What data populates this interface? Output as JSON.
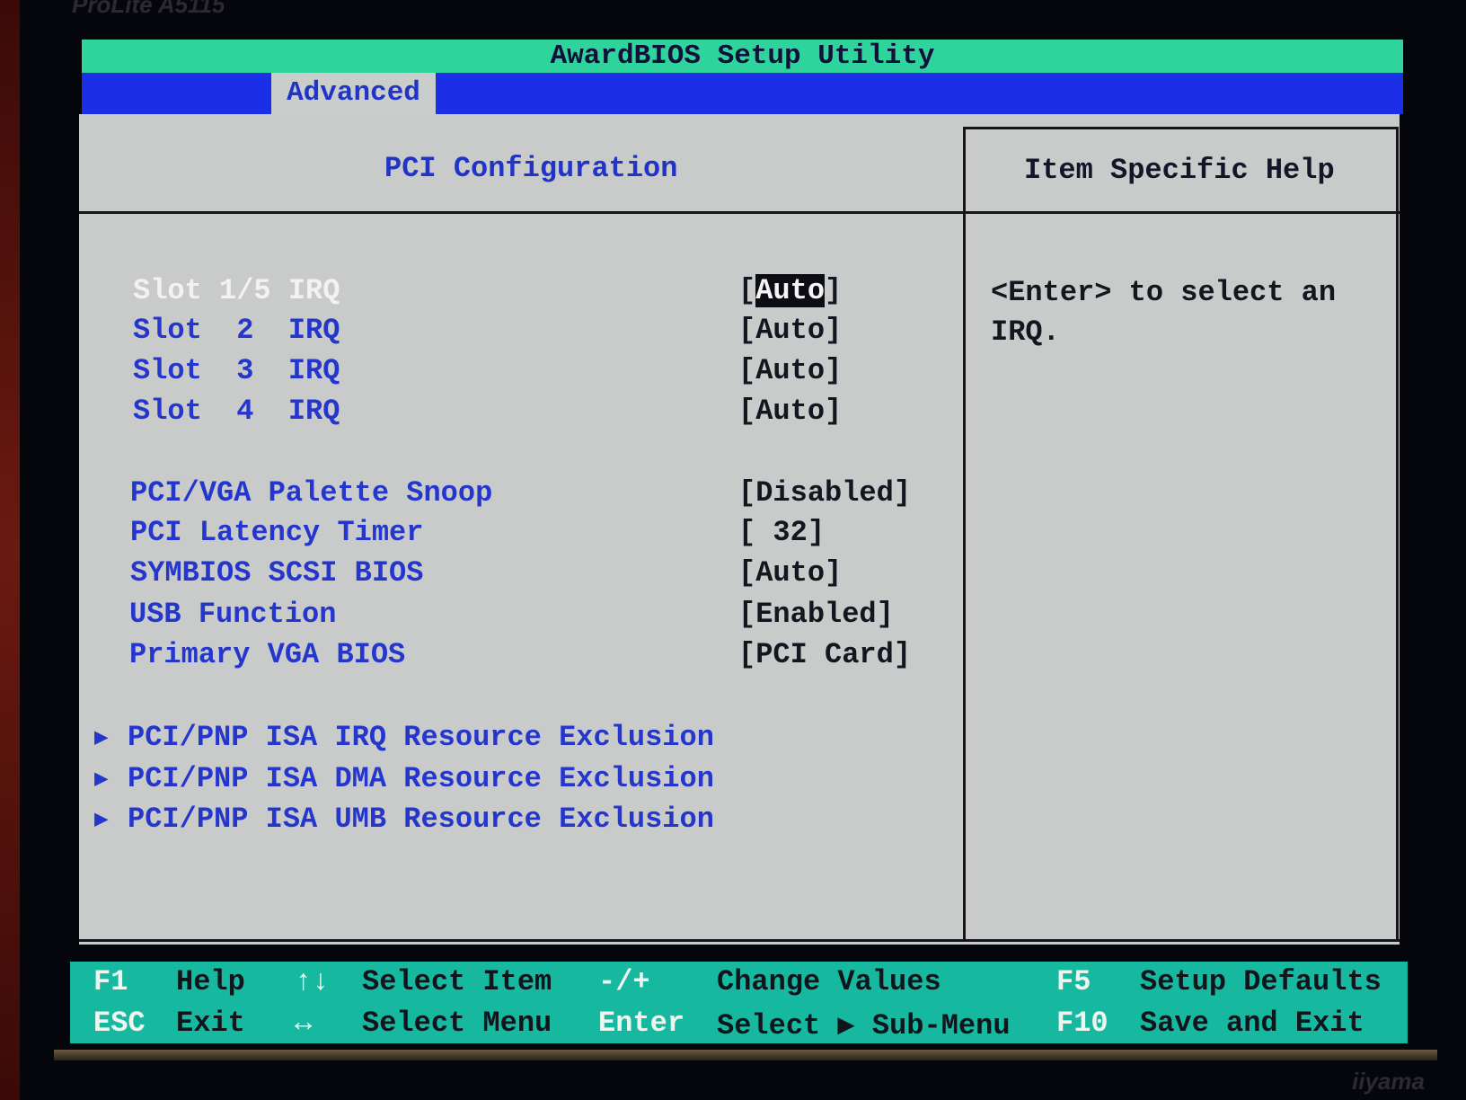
{
  "monitor": {
    "model": "ProLite A5115",
    "brand": "iiyama"
  },
  "title": "AwardBIOS Setup Utility",
  "menu": {
    "tabs": [
      {
        "label": "Advanced",
        "active": true
      }
    ]
  },
  "panel": {
    "header": "PCI Configuration",
    "help_header": "Item Specific Help",
    "help_lines": [
      "<Enter> to select an",
      "IRQ."
    ],
    "items": [
      {
        "label": "Slot 1/5 IRQ",
        "value_open": "[",
        "value": "Auto",
        "value_close": "]",
        "selected": true
      },
      {
        "label": "Slot  2  IRQ",
        "value": "[Auto]"
      },
      {
        "label": "Slot  3  IRQ",
        "value": "[Auto]"
      },
      {
        "label": "Slot  4  IRQ",
        "value": "[Auto]"
      },
      {
        "label": "PCI/VGA Palette Snoop",
        "value": "[Disabled]"
      },
      {
        "label": "PCI Latency Timer",
        "value": "[ 32]"
      },
      {
        "label": "SYMBIOS SCSI BIOS",
        "value": "[Auto]"
      },
      {
        "label": "USB Function",
        "value": "[Enabled]"
      },
      {
        "label": "Primary VGA BIOS",
        "value": "[PCI Card]"
      }
    ],
    "submenus": [
      {
        "label": "PCI/PNP ISA IRQ Resource Exclusion"
      },
      {
        "label": "PCI/PNP ISA DMA Resource Exclusion"
      },
      {
        "label": "PCI/PNP ISA UMB Resource Exclusion"
      }
    ]
  },
  "footer": {
    "keys": [
      {
        "key": "F1",
        "desc": "Help"
      },
      {
        "key": "ESC",
        "desc": "Exit"
      },
      {
        "key": "↑↓",
        "desc": "Select Item"
      },
      {
        "key": "↔",
        "desc": "Select Menu"
      },
      {
        "key": "-/+",
        "desc": "Change Values"
      },
      {
        "key": "Enter",
        "desc": "Select ▶ Sub-Menu"
      },
      {
        "key": "F5",
        "desc": "Setup Defaults"
      },
      {
        "key": "F10",
        "desc": "Save and Exit"
      }
    ]
  },
  "colors": {
    "title_bar": "#2fd49c",
    "menu_bar": "#1b2fe6",
    "panel": "#c8cbca",
    "label_text": "#2536cc",
    "footer": "#17b8a0"
  }
}
